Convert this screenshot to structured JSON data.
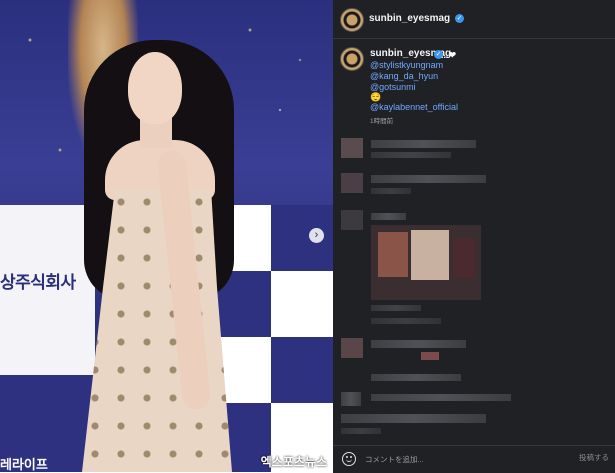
{
  "post": {
    "username": "sunbin_eyesmag",
    "caption_suffix": "...❤",
    "mentions": [
      "@stylistkyungnam",
      "@kang_da_hyun",
      "@gotsunmi",
      "@kaylabennet_official"
    ],
    "emoji_line_1": "😌",
    "emoji_line_2": "😊",
    "time_ago": "1時間前"
  },
  "photo": {
    "sponsor_text": "상주식회사",
    "sponsor_text_bottom": "레라이프",
    "watermark": "엑스포츠뉴스",
    "next_icon": "chevron-right-icon"
  },
  "comment_bar": {
    "placeholder": "コメントを追加...",
    "post_label": "投稿する",
    "emoji_icon": "smile-icon"
  },
  "colors": {
    "panel_bg": "#202124",
    "link": "#6fa8ff",
    "verified": "#3897f0"
  }
}
